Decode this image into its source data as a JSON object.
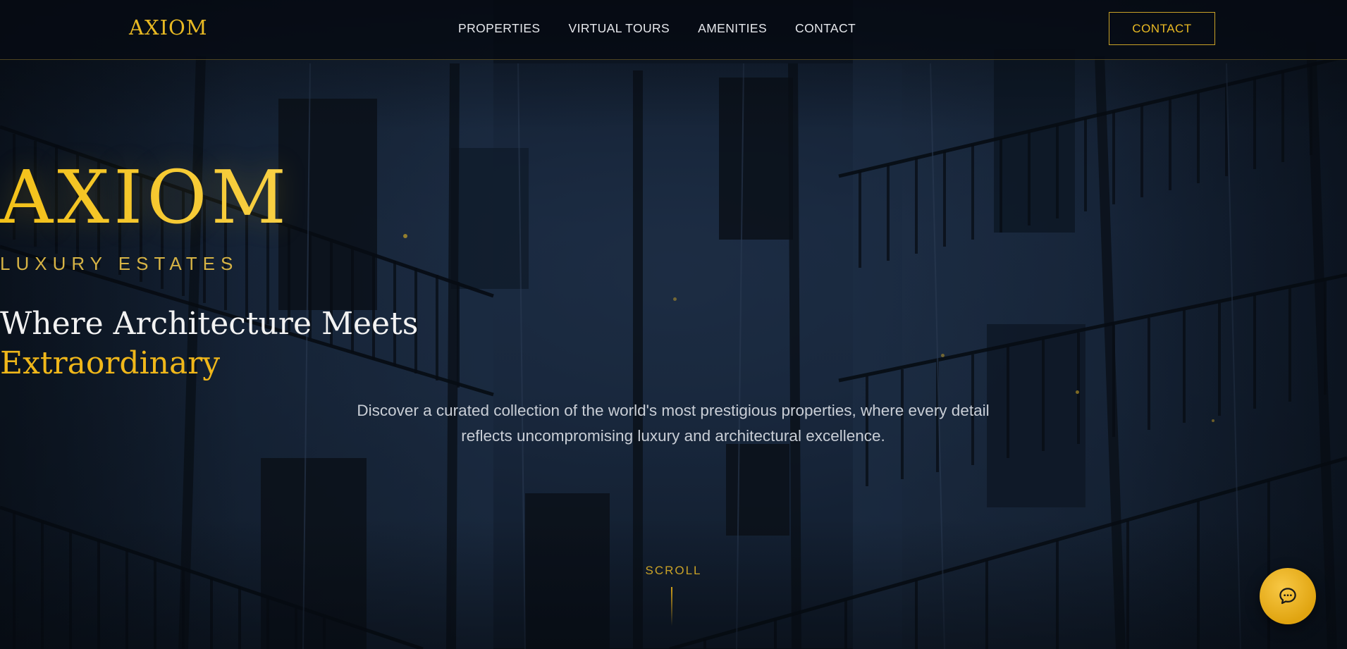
{
  "navbar": {
    "logo": "AXIOM",
    "links": [
      "PROPERTIES",
      "VIRTUAL TOURS",
      "AMENITIES",
      "CONTACT"
    ],
    "cta_label": "CONTACT"
  },
  "hero": {
    "brand_title": "AXIOM",
    "brand_subtitle": "LUXURY ESTATES",
    "headline": "Where Architecture Meets",
    "headline_accent": "Extraordinary",
    "description": "Discover a curated collection of the world's most prestigious properties, where every detail reflects uncompromising luxury and architectural excellence.",
    "scroll_label": "SCROLL"
  },
  "chat": {
    "icon": "chat-bubble-icon"
  },
  "colors": {
    "accent_gold": "#e8b923",
    "background_navy": "#0b1420",
    "text_light": "#e6e8ec"
  }
}
